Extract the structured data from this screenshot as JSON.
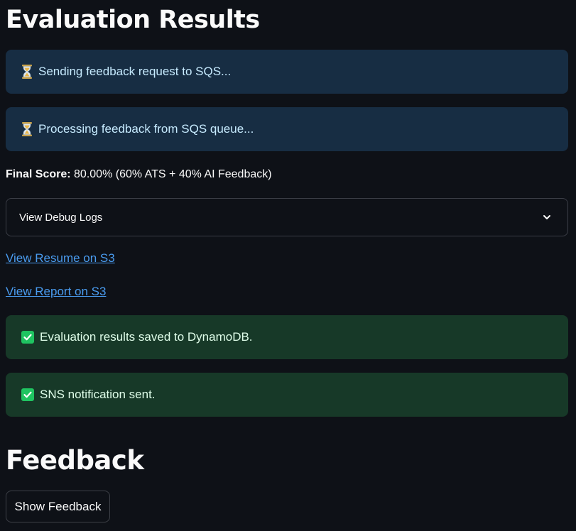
{
  "title": "Evaluation Results",
  "alerts": {
    "sending": "Sending feedback request to SQS...",
    "processing": "Processing feedback from SQS queue...",
    "saved": "Evaluation results saved to DynamoDB.",
    "sns": "SNS notification sent."
  },
  "score": {
    "label": "Final Score:",
    "value": "80.00% (60% ATS + 40% AI Feedback)"
  },
  "expander": {
    "label": "View Debug Logs"
  },
  "links": {
    "resume": "View Resume on S3",
    "report": "View Report on S3"
  },
  "feedback": {
    "heading": "Feedback",
    "button": "Show Feedback"
  },
  "icons": {
    "info_alert": "hourglass-icon",
    "success_alert": "check-box-icon",
    "expander": "chevron-down-icon"
  },
  "colors": {
    "background": "#0e1117",
    "info_bg": "#172d43",
    "success_bg": "#173928",
    "link": "#4a9cf0",
    "check": "#1fc461"
  }
}
